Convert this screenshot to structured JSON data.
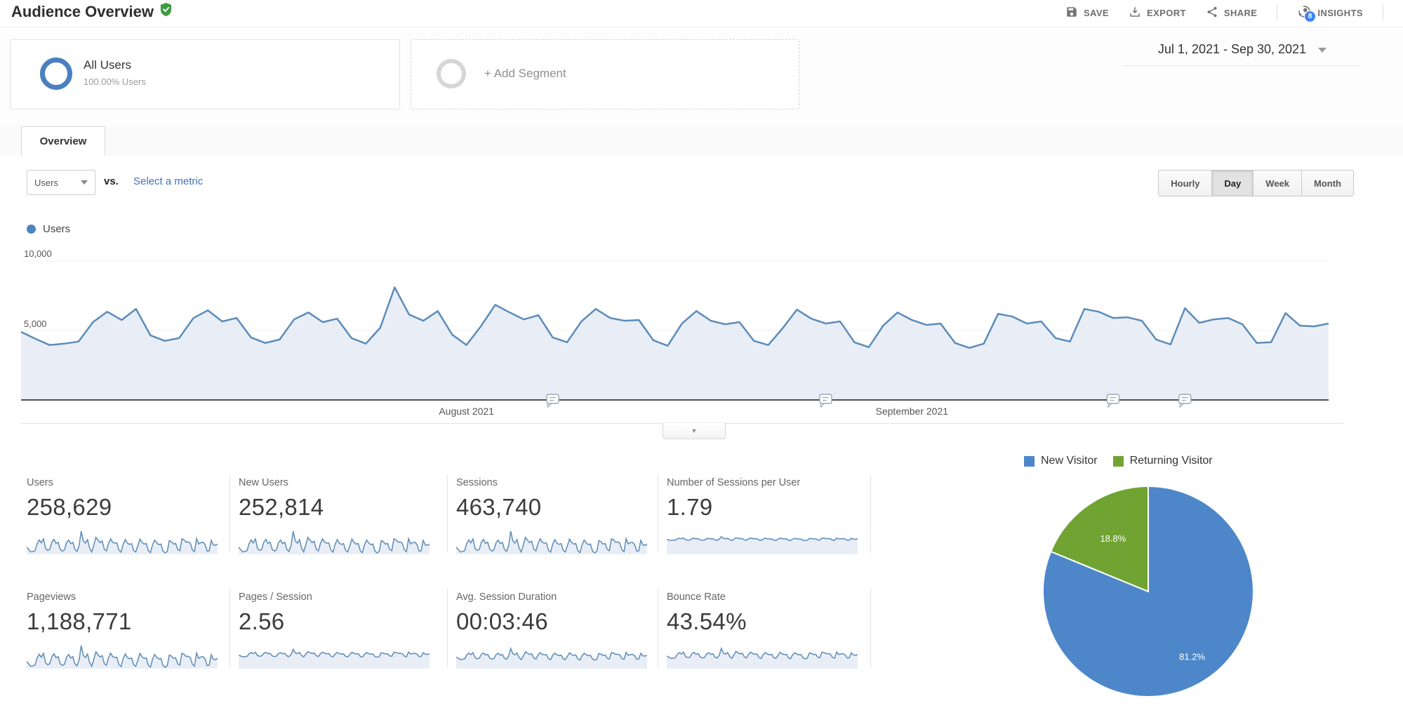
{
  "theme": {
    "accent_blue": "#4285f4",
    "link_blue": "#4272b8",
    "icon_gray": "#757575",
    "shield_green": "#3d9c40"
  },
  "header": {
    "title": "Audience Overview",
    "actions": [
      {
        "label": "SAVE",
        "icon": "save-icon"
      },
      {
        "label": "EXPORT",
        "icon": "export-icon"
      },
      {
        "label": "SHARE",
        "icon": "share-icon"
      },
      {
        "label": "INSIGHTS",
        "icon": "insights-icon",
        "badge": "8"
      }
    ]
  },
  "segments": {
    "all_users": {
      "name": "All Users",
      "detail": "100.00% Users"
    },
    "add": {
      "label": "+ Add Segment"
    }
  },
  "date_range": "Jul 1, 2021 - Sep 30, 2021",
  "tabs": [
    {
      "label": "Overview",
      "active": true
    }
  ],
  "toolbar": {
    "metric_selector": "Users",
    "vs_label": "vs.",
    "select_metric_label": "Select a metric",
    "granularity": [
      {
        "label": "Hourly",
        "active": false
      },
      {
        "label": "Day",
        "active": true
      },
      {
        "label": "Week",
        "active": false
      },
      {
        "label": "Month",
        "active": false
      }
    ]
  },
  "chart_data": [
    {
      "type": "area",
      "title": "Users by day",
      "x": {
        "start": "Jul 1, 2021",
        "end": "Sep 30, 2021",
        "unit": "day",
        "points": 92
      },
      "series": [
        {
          "name": "Users",
          "values": [
            4900,
            4400,
            3950,
            4050,
            4200,
            5600,
            6350,
            5750,
            6550,
            4650,
            4250,
            4450,
            5900,
            6450,
            5650,
            5900,
            4500,
            4100,
            4350,
            5800,
            6300,
            5600,
            5850,
            4450,
            4050,
            5200,
            8100,
            6150,
            5700,
            6400,
            4700,
            3950,
            5300,
            6850,
            6300,
            5800,
            6100,
            4500,
            4150,
            5650,
            6550,
            5900,
            5700,
            5750,
            4300,
            3900,
            5500,
            6400,
            5700,
            5450,
            5600,
            4250,
            3950,
            5150,
            6500,
            5850,
            5500,
            5650,
            4150,
            3800,
            5350,
            6300,
            5750,
            5400,
            5500,
            4100,
            3750,
            4050,
            6200,
            6000,
            5500,
            5650,
            4450,
            4200,
            6550,
            6350,
            5900,
            5950,
            5700,
            4350,
            4000,
            6600,
            5550,
            5800,
            5900,
            5450,
            4100,
            4150,
            6250,
            5350,
            5300,
            5500
          ]
        }
      ],
      "ylim": [
        0,
        10500
      ],
      "y_ticks": [
        {
          "label": "10,000",
          "value": 10000
        },
        {
          "label": "5,000",
          "value": 5000
        }
      ],
      "month_labels": [
        {
          "label": "August 2021",
          "day_index": 31
        },
        {
          "label": "September 2021",
          "day_index": 62
        }
      ],
      "annotations_day_index": [
        37,
        56,
        76,
        81
      ],
      "grid": true,
      "legend_position": "top-left",
      "colors": {
        "line": "#5b8cbb",
        "area": "#e9eef6",
        "axis": "#4f4f4f",
        "legend_dot": "#4d84c4",
        "grid": "#f0f0f0"
      }
    },
    {
      "type": "pie",
      "title": "New vs Returning Visitors",
      "slices": [
        {
          "label": "New Visitor",
          "pct": 81.2,
          "display": "81.2%",
          "color": "#4d87c9"
        },
        {
          "label": "Returning Visitor",
          "pct": 18.8,
          "display": "18.8%",
          "color": "#70a331"
        }
      ],
      "legend_position": "top"
    }
  ],
  "metrics": [
    {
      "label": "Users",
      "value": "258,629",
      "spark": {
        "style": "jagged"
      }
    },
    {
      "label": "New Users",
      "value": "252,814",
      "spark": {
        "style": "jagged"
      }
    },
    {
      "label": "Sessions",
      "value": "463,740",
      "spark": {
        "style": "jagged"
      }
    },
    {
      "label": "Number of Sessions per User",
      "value": "1.79",
      "spark": {
        "style": "band",
        "level": 0.62,
        "amp": 0.06
      }
    },
    {
      "label": "Pageviews",
      "value": "1,188,771",
      "spark": {
        "style": "jagged"
      }
    },
    {
      "label": "Pages / Session",
      "value": "2.56",
      "spark": {
        "style": "band",
        "level": 0.6,
        "amp": 0.12
      }
    },
    {
      "label": "Avg. Session Duration",
      "value": "00:03:46",
      "spark": {
        "style": "band",
        "level": 0.55,
        "amp": 0.18
      }
    },
    {
      "label": "Bounce Rate",
      "value": "43.54%",
      "spark": {
        "style": "band",
        "level": 0.58,
        "amp": 0.16
      }
    }
  ]
}
